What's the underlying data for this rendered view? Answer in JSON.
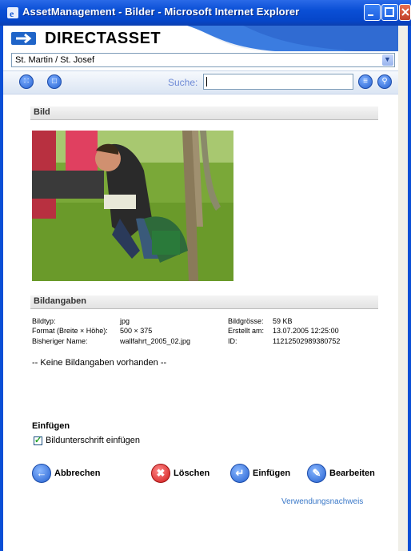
{
  "window": {
    "title": "AssetManagement - Bilder - Microsoft Internet Explorer"
  },
  "header": {
    "brand": "DIRECTASSET"
  },
  "location": {
    "value": "St. Martin / St. Josef"
  },
  "toolbar": {
    "search_label": "Suche:",
    "search_value": ""
  },
  "section_image": {
    "title": "Bild"
  },
  "section_info": {
    "title": "Bildangaben",
    "fields_left": [
      {
        "label": "Bildtyp:",
        "value": "jpg"
      },
      {
        "label": "Format (Breite × Höhe):",
        "value": "500 × 375"
      },
      {
        "label": "Bisheriger Name:",
        "value": "wallfahrt_2005_02.jpg"
      }
    ],
    "fields_right": [
      {
        "label": "Bildgrösse:",
        "value": "59 KB"
      },
      {
        "label": "Erstellt am:",
        "value": "13.07.2005 12:25:00"
      },
      {
        "label": "ID:",
        "value": "11212502989380752"
      }
    ],
    "note": "-- Keine Bildangaben vorhanden --"
  },
  "insert": {
    "title": "Einfügen",
    "checkbox_label": "Bildunterschrift einfügen",
    "checkbox_checked": true
  },
  "actions": {
    "cancel": "Abbrechen",
    "delete": "Löschen",
    "insert": "Einfügen",
    "edit": "Bearbeiten"
  },
  "link": {
    "usage": "Verwendungsnachweis"
  }
}
